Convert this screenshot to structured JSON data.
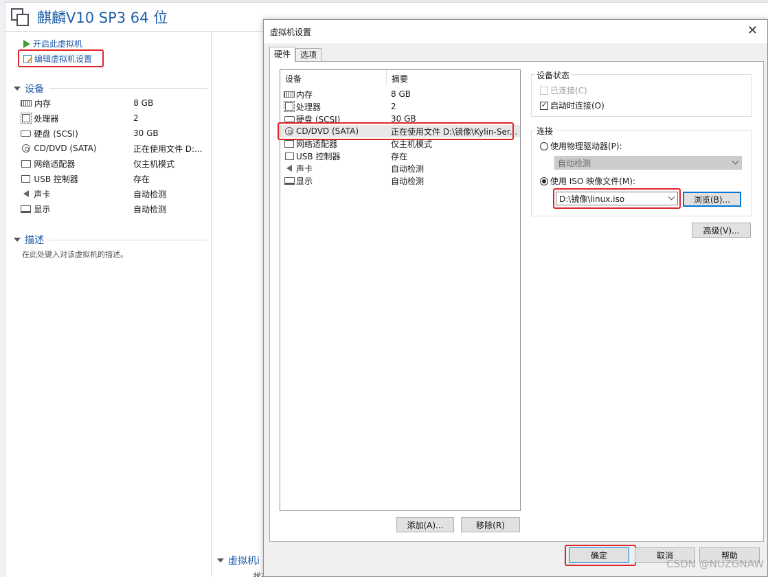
{
  "vm": {
    "title": "麒麟V10 SP3 64 位",
    "actions": {
      "power_on": "开启此虚拟机",
      "edit_settings": "编辑虚拟机设置"
    },
    "devices_section": "设备",
    "devices": [
      {
        "icon": "memory-icon",
        "name": "内存",
        "value": "8 GB"
      },
      {
        "icon": "cpu-icon",
        "name": "处理器",
        "value": "2"
      },
      {
        "icon": "harddisk-icon",
        "name": "硬盘 (SCSI)",
        "value": "30 GB"
      },
      {
        "icon": "cd-dvd-icon",
        "name": "CD/DVD (SATA)",
        "value": "正在使用文件 D:..."
      },
      {
        "icon": "network-icon",
        "name": "网络适配器",
        "value": "仅主机模式"
      },
      {
        "icon": "usb-icon",
        "name": "USB 控制器",
        "value": "存在"
      },
      {
        "icon": "sound-icon",
        "name": "声卡",
        "value": "自动检测"
      },
      {
        "icon": "display-icon",
        "name": "显示",
        "value": "自动检测"
      }
    ],
    "description_section": "描述",
    "description_placeholder": "在此处键入对该虚拟机的描述。",
    "details_section_partial": "虚拟机i",
    "status_partial": "状态: 已关机"
  },
  "dialog": {
    "title": "虚拟机设置",
    "close": "✕",
    "tabs": [
      "硬件",
      "选项"
    ],
    "active_tab": "硬件",
    "list_headers": {
      "device": "设备",
      "summary": "摘要"
    },
    "hardware": [
      {
        "icon": "memory-icon",
        "name": "内存",
        "summary": "8 GB"
      },
      {
        "icon": "cpu-icon",
        "name": "处理器",
        "summary": "2"
      },
      {
        "icon": "harddisk-icon",
        "name": "硬盘 (SCSI)",
        "summary": "30 GB"
      },
      {
        "icon": "cd-dvd-icon",
        "name": "CD/DVD (SATA)",
        "summary": "正在使用文件 D:\\镜像\\Kylin-Ser..."
      },
      {
        "icon": "network-icon",
        "name": "网络适配器",
        "summary": "仅主机模式"
      },
      {
        "icon": "usb-icon",
        "name": "USB 控制器",
        "summary": "存在"
      },
      {
        "icon": "sound-icon",
        "name": "声卡",
        "summary": "自动检测"
      },
      {
        "icon": "display-icon",
        "name": "显示",
        "summary": "自动检测"
      }
    ],
    "selected_device": "CD/DVD (SATA)",
    "add_button": "添加(A)...",
    "remove_button": "移除(R)",
    "device_status": {
      "label": "设备状态",
      "connected": {
        "label": "已连接(C)",
        "checked": false,
        "disabled": true
      },
      "connect_at_power_on": {
        "label": "启动时连接(O)",
        "checked": true
      }
    },
    "connection": {
      "label": "连接",
      "physical_drive": {
        "label": "使用物理驱动器(P):",
        "selected": false
      },
      "physical_drive_value": "自动检测",
      "iso_file": {
        "label": "使用 ISO 映像文件(M):",
        "selected": true
      },
      "iso_path": "D:\\镜像\\linux.iso",
      "browse_button": "浏览(B)..."
    },
    "advanced_button": "高级(V)...",
    "ok_button": "确定",
    "cancel_button": "取消",
    "help_button": "帮助"
  },
  "watermark": "CSDN @NUZGNAW",
  "colors": {
    "highlight_red": "#e0232b",
    "link_blue": "#1d5aa8",
    "focus_blue": "#0078d7",
    "dialog_bg": "#f0f0f0"
  }
}
